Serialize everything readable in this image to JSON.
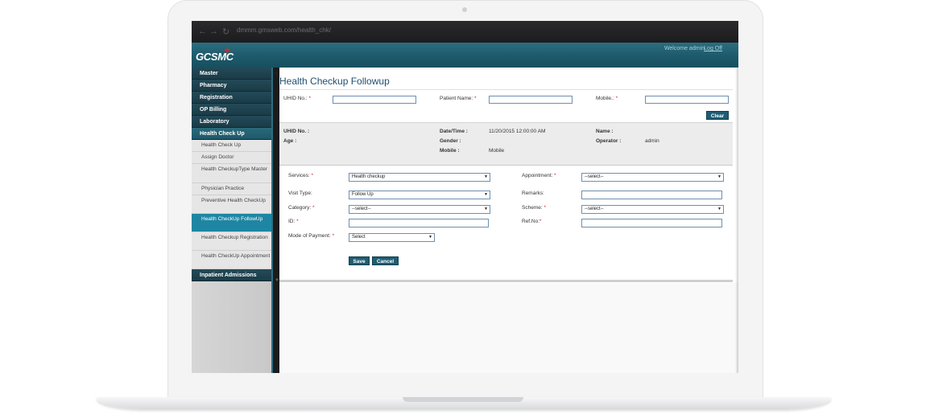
{
  "browser": {
    "url": "dmmm.gmsweb.com/health_chk/"
  },
  "header": {
    "logo": "GCSMC",
    "logo_mark": "+",
    "welcome": "Welcome admin",
    "logoff": "Log Off"
  },
  "sidebar": {
    "items": [
      {
        "label": "Master"
      },
      {
        "label": "Pharmacy"
      },
      {
        "label": "Registration"
      },
      {
        "label": "OP Billing"
      },
      {
        "label": "Laboratory"
      },
      {
        "label": "Health Check Up"
      }
    ],
    "subitems": [
      {
        "label": "Health Check Up"
      },
      {
        "label": "Assign Doctor"
      },
      {
        "label": "Health CheckupType Master"
      },
      {
        "label": "Physician Practice"
      },
      {
        "label": "Preventive Health CheckUp"
      },
      {
        "label": "Health CheckUp FollowUp"
      },
      {
        "label": "Health Checkup Registration"
      },
      {
        "label": "Health CheckUp Appointment"
      }
    ],
    "bottom_item": {
      "label": "Inpatient Admissions"
    }
  },
  "page": {
    "title": "Health Checkup Followup"
  },
  "search": {
    "uhid_label": "UHID No.:",
    "patient_name_label": "Patient Name:",
    "mobile_label": "Mobile.:",
    "required_mark": "*",
    "clear_label": "Clear"
  },
  "info": {
    "uhid_label": "UHID No. :",
    "age_label": "Age :",
    "datetime_label": "Date/Time :",
    "datetime_value": "11/20/2015 12:00:00 AM",
    "gender_label": "Gender :",
    "mobile_label": "Mobile :",
    "mobile_value": "Mobile",
    "name_label": "Name :",
    "operator_label": "Operator :",
    "operator_value": "admin"
  },
  "form": {
    "services_label": "Services:",
    "services_value": "Health checkup",
    "appointment_label": "Appointment:",
    "appointment_value": "--select--",
    "visit_type_label": "Visit Type:",
    "visit_type_value": "Follow Up",
    "remarks_label": "Remarks:",
    "category_label": "Category:",
    "category_value": "--select--",
    "scheme_label": "Scheme:",
    "scheme_value": "--select--",
    "id_label": "ID:",
    "refno_label": "Ref.No:",
    "mode_of_payment_label": "Mode of Payment:",
    "mode_of_payment_value": "Select",
    "save_label": "Save",
    "cancel_label": "Cancel"
  },
  "colors": {
    "header": "#1d5a6b",
    "sidebar_item": "#1a3c48",
    "active_subitem": "#1e86a3",
    "button": "#1f5d73",
    "title": "#1f4e6e"
  }
}
